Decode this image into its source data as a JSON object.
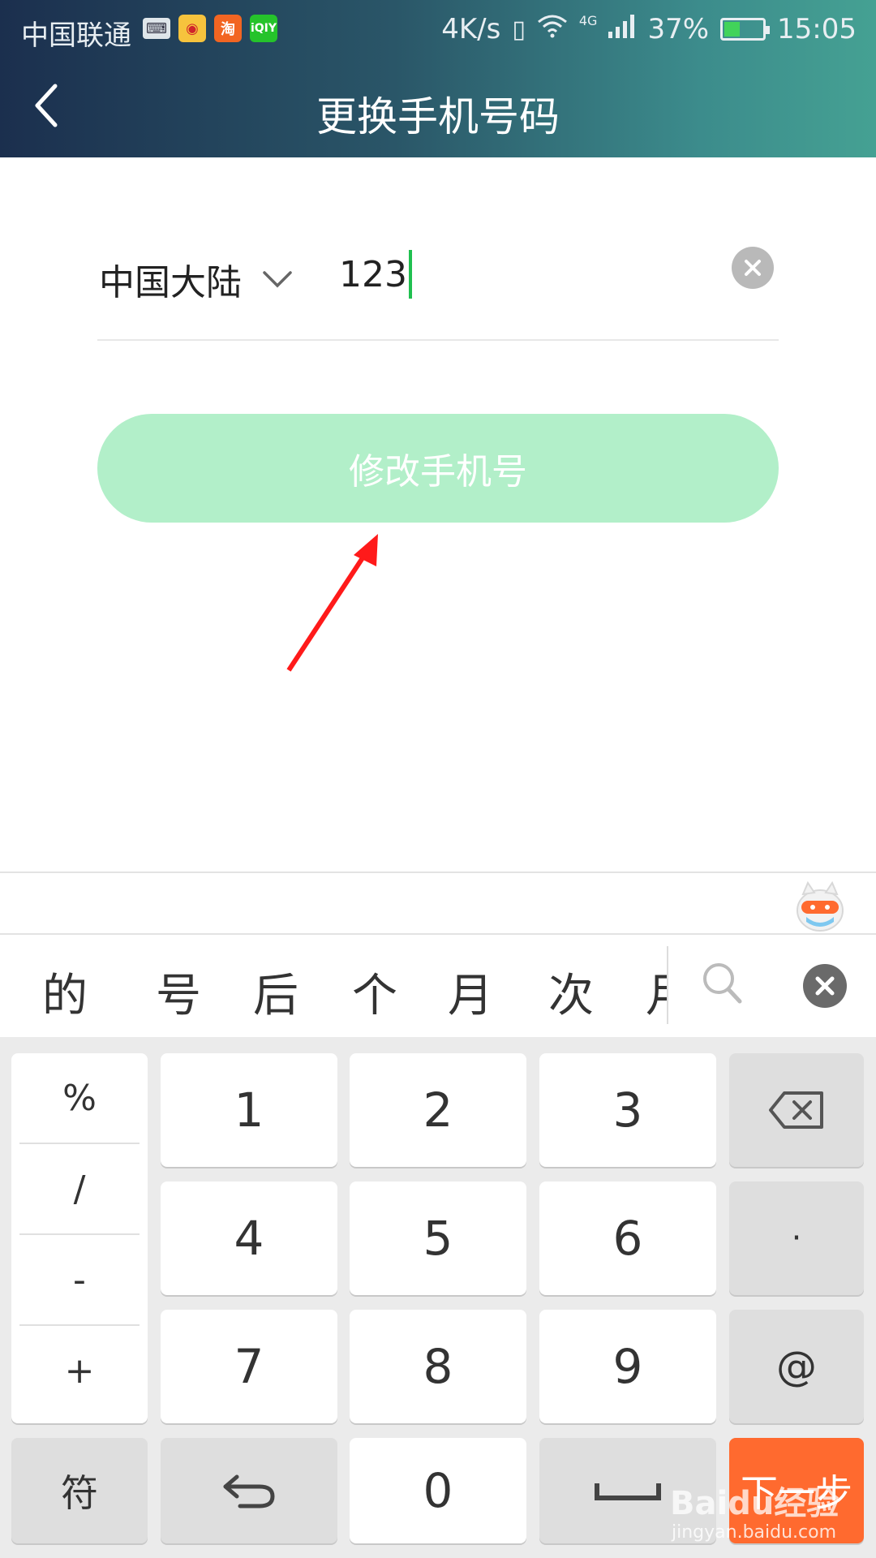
{
  "status_bar": {
    "carrier": "中国联通",
    "network_speed": "4K/s",
    "network_type": "4G",
    "battery": "37%",
    "time": "15:05",
    "app_icons": [
      "keyboard-icon",
      "weibo-icon",
      "taobao-icon",
      "iqiyi-icon"
    ],
    "taobao_label": "淘",
    "iqiyi_label": "iQIY"
  },
  "header": {
    "title": "更换手机号码",
    "back_icon": "chevron-left-icon"
  },
  "form": {
    "country": "中国大陆",
    "phone_value": "123",
    "submit_label": "修改手机号"
  },
  "keyboard": {
    "candidates": [
      "的",
      "号",
      "后",
      "个",
      "月",
      "次",
      "月"
    ],
    "symbols": [
      "%",
      "/",
      "-",
      "+"
    ],
    "digits": [
      "1",
      "2",
      "3",
      "4",
      "5",
      "6",
      "7",
      "8",
      "9",
      "0"
    ],
    "dot_key": "·",
    "at_key": "@",
    "symbol_key": "符",
    "next_key": "下一步"
  },
  "watermark": {
    "text": "Baidu经验",
    "url": "jingyan.baidu.com"
  },
  "colors": {
    "header_start": "#1b2f4e",
    "header_end": "#45a193",
    "submit_bg": "#b2efc9",
    "caret": "#20c050",
    "next_key_bg": "#ff6a2f",
    "annotation_arrow": "#ff1a1a"
  }
}
